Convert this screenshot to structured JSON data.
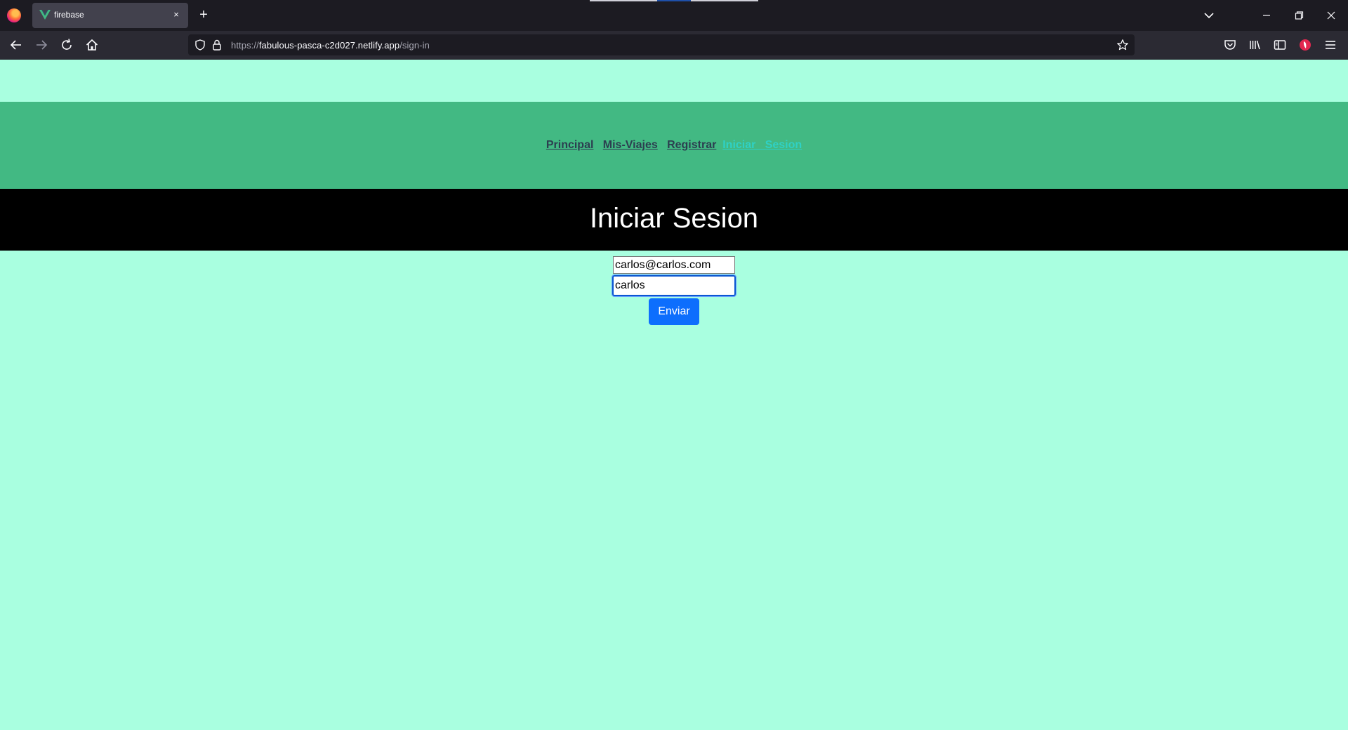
{
  "browser": {
    "tab_title": "firebase",
    "tab_close_glyph": "×",
    "new_tab_glyph": "+",
    "url_prefix": "https://",
    "url_host": "fabulous-pasca-c2d027.netlify.app",
    "url_path": "/sign-in",
    "icons": [
      "firefox-logo-icon",
      "vue-favicon-icon",
      "list-all-tabs-icon",
      "minimize-icon",
      "restore-icon",
      "close-window-icon",
      "back-icon",
      "forward-icon",
      "reload-icon",
      "home-icon",
      "shield-icon",
      "lock-icon",
      "bookmark-star-icon",
      "pocket-icon",
      "library-icon",
      "sidebar-icon",
      "extension-icon",
      "menu-icon"
    ]
  },
  "nav": {
    "links": [
      {
        "label": "Principal"
      },
      {
        "label": "Mis-Viajes"
      },
      {
        "label": "Registrar"
      },
      {
        "label": "Iniciar   Sesion"
      }
    ]
  },
  "page": {
    "heading": "Iniciar Sesion"
  },
  "form": {
    "email_value": "carlos@carlos.com",
    "password_value": "carlos",
    "submit_label": "Enviar"
  },
  "colors": {
    "page_bg": "#a9ffe0",
    "nav_bg": "#42b983",
    "nav_link": "#2c3e50",
    "nav_link_active": "#2fd1c5",
    "banner_bg": "#000000",
    "button_bg": "#0d6efd"
  }
}
